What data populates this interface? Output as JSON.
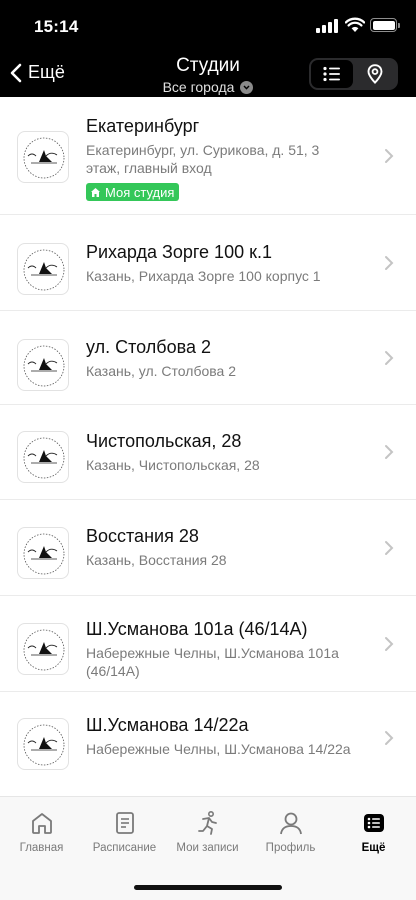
{
  "status": {
    "time": "15:14"
  },
  "header": {
    "back_label": "Ещё",
    "title": "Студии",
    "subtitle": "Все города"
  },
  "studios": [
    {
      "title": "Екатеринбург",
      "address_line1": "Екатеринбург, ул. Сурикова, д. 51, 3",
      "address_line2": "этаж, главный вход",
      "badge": "Моя студия"
    },
    {
      "title": "Рихарда Зорге 100 к.1",
      "address_line1": "Казань, Рихарда Зорге 100 корпус 1"
    },
    {
      "title": "ул. Столбова 2",
      "address_line1": "Казань, ул. Столбова 2"
    },
    {
      "title": "Чистопольская, 28",
      "address_line1": "Казань, Чистопольская, 28"
    },
    {
      "title": "Восстания 28",
      "address_line1": "Казань, Восстания 28"
    },
    {
      "title": "Ш.Усманова 101а (46/14А)",
      "address_line1": "Набережные Челны, Ш.Усманова 101а",
      "address_line2": "(46/14А)"
    },
    {
      "title": "Ш.Усманова 14/22а",
      "address_line1": "Набережные Челны, Ш.Усманова 14/22а"
    }
  ],
  "tabbar": {
    "items": [
      {
        "label": "Главная",
        "icon": "home-icon"
      },
      {
        "label": "Расписание",
        "icon": "schedule-icon"
      },
      {
        "label": "Мои записи",
        "icon": "bookings-icon"
      },
      {
        "label": "Профиль",
        "icon": "profile-icon"
      },
      {
        "label": "Ещё",
        "icon": "more-icon",
        "active": true
      }
    ]
  },
  "colors": {
    "header_bg": "#000000",
    "badge_green": "#34c759",
    "chevron_gray": "#c4c4c4"
  }
}
